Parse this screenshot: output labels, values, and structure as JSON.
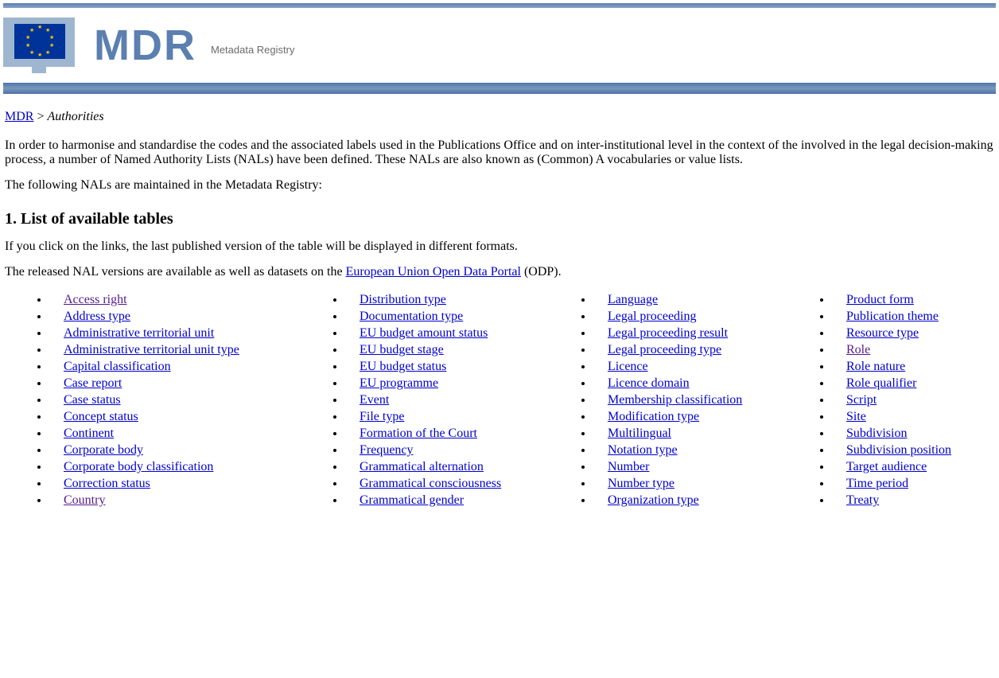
{
  "header": {
    "logo_text": "MDR",
    "logo_subtitle": "Metadata Registry"
  },
  "breadcrumb": {
    "root": "MDR",
    "sep": " > ",
    "current": "Authorities"
  },
  "intro_para_1": "In order to harmonise and standardise the codes and the associated labels used in the Publications Office and on inter-institutional level in the context of the involved in the legal decision-making process, a number of Named Authority Lists (NALs) have been defined. These NALs are also known as (Common) A vocabularies or value lists.",
  "intro_para_2": "The following NALs are maintained in the Metadata Registry:",
  "section_heading": "1. List of available tables",
  "section_para_1": "If you click on the links, the last published version of the table will be displayed in different formats.",
  "section_para_2_prefix": "The released NAL versions are available as well as datasets on the ",
  "section_para_2_link": "European Union Open Data Portal",
  "section_para_2_suffix": " (ODP).",
  "columns": [
    {
      "items": [
        {
          "label": "Access right",
          "visited": true
        },
        {
          "label": "Address type",
          "visited": false
        },
        {
          "label": "Administrative territorial unit",
          "visited": false
        },
        {
          "label": "Administrative territorial unit type",
          "visited": false
        },
        {
          "label": "Capital classification",
          "visited": false
        },
        {
          "label": "Case report",
          "visited": false
        },
        {
          "label": "Case status",
          "visited": false
        },
        {
          "label": "Concept status",
          "visited": false
        },
        {
          "label": "Continent",
          "visited": false
        },
        {
          "label": "Corporate body",
          "visited": false
        },
        {
          "label": "Corporate body classification",
          "visited": false
        },
        {
          "label": "Correction status",
          "visited": false
        },
        {
          "label": "Country",
          "visited": true
        }
      ]
    },
    {
      "items": [
        {
          "label": "Distribution type",
          "visited": false
        },
        {
          "label": "Documentation type",
          "visited": false
        },
        {
          "label": "EU budget amount status",
          "visited": false
        },
        {
          "label": "EU budget stage",
          "visited": false
        },
        {
          "label": "EU budget status",
          "visited": false
        },
        {
          "label": "EU programme",
          "visited": false
        },
        {
          "label": "Event",
          "visited": false
        },
        {
          "label": "File type",
          "visited": false
        },
        {
          "label": "Formation of the Court",
          "visited": false
        },
        {
          "label": "Frequency",
          "visited": false
        },
        {
          "label": "Grammatical alternation",
          "visited": false
        },
        {
          "label": "Grammatical consciousness",
          "visited": false
        },
        {
          "label": "Grammatical gender",
          "visited": false
        }
      ]
    },
    {
      "items": [
        {
          "label": "Language",
          "visited": false
        },
        {
          "label": "Legal proceeding",
          "visited": false
        },
        {
          "label": "Legal proceeding result",
          "visited": false
        },
        {
          "label": "Legal proceeding type",
          "visited": false
        },
        {
          "label": "Licence",
          "visited": false
        },
        {
          "label": "Licence domain",
          "visited": false
        },
        {
          "label": "Membership classification",
          "visited": false
        },
        {
          "label": "Modification type",
          "visited": false
        },
        {
          "label": "Multilingual",
          "visited": false
        },
        {
          "label": "Notation type",
          "visited": false
        },
        {
          "label": "Number",
          "visited": false
        },
        {
          "label": "Number type",
          "visited": false
        },
        {
          "label": "Organization type",
          "visited": false
        }
      ]
    },
    {
      "items": [
        {
          "label": "Product form",
          "visited": false
        },
        {
          "label": "Publication theme",
          "visited": false
        },
        {
          "label": "Resource type",
          "visited": false
        },
        {
          "label": "Role",
          "visited": true
        },
        {
          "label": "Role nature",
          "visited": false
        },
        {
          "label": "Role qualifier",
          "visited": false
        },
        {
          "label": "Script",
          "visited": false
        },
        {
          "label": "Site",
          "visited": false
        },
        {
          "label": "Subdivision",
          "visited": false
        },
        {
          "label": "Subdivision position",
          "visited": false
        },
        {
          "label": "Target audience",
          "visited": false
        },
        {
          "label": "Time period",
          "visited": false
        },
        {
          "label": "Treaty",
          "visited": false
        }
      ]
    }
  ]
}
